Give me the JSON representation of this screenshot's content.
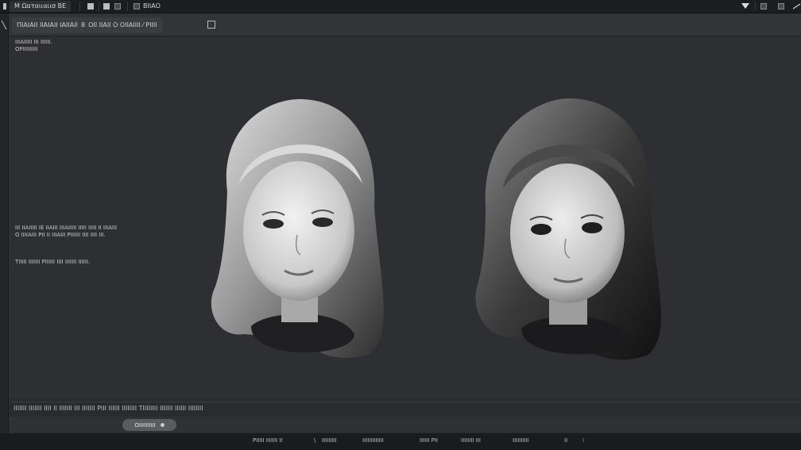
{
  "topbar": {
    "app_title": "M Ωαταιιαιισ ΒΕ",
    "menu_label": "ΒΙΙΑΟ",
    "icons": [
      "window-icon",
      "grid-icon",
      "layers-icon",
      "dropdown-arrow-icon",
      "frame-icon",
      "maximize-icon",
      "close-icon"
    ]
  },
  "tab": {
    "label": "ΠΙΑΙΑΙΙ ΙΙΑΙΑΙΙ ΙΑΙΙΑΙΙ",
    "sep": "8",
    "extra": "ΟΙΙ ΙΙΑΙΙ Ο ΟΙΙΑΙΙΙΙ ⁄ ΡΙΙΙΙ"
  },
  "notes": {
    "top": [
      "ΙΙΙΑΙΙΙΙΙ ΙΙΙ ΙΙΙΙΙΙ.",
      "ΟΡΙΙΙΙΙΙΙΙΙ"
    ],
    "middle": [
      "ΙΙΙ ΙΙΑΙΙΙΙΙ ΙΕ ΙΙΑΙΙΙ ΙΙΙΑΙΙΙΙΙ ΙΙΙΙΙ ΙΙΙΙΙ ΙΙ ΙΙΙΑΙΙΙ",
      "Ο ΙΙΙΙΑΙΙΙ ΡΙΙ ΙΙ ΙΙΙΑΙΙΙ ΡΙΙΙΙΙΙ ΙΙΙΙ ΙΙΙΙ ΙΙΙ."
    ],
    "bottom": "ΤΙΙΙΙΙ ΙΙΙΙΙΙΙ ΡΙΙΙΙΙΙ ΙΙΙΙ ΙΙΙΙΙΙΙ ΙΙΙΙΙΙ."
  },
  "status": "ΙΙΙΙΙΙΙ ΙΙΙΙΙΙΙ ΙΙΙΙ ΙΙ ΙΙΙΙΙΙΙ ΙΙΙ ΙΙΙΙΙΙΙ ΡΙΙΙ ΙΙΙΙΙΙ ΙΙΙΙΙΙΙΙ ΤΙΙΙΙΙΙΙΙ ΙΙΙΙΙΙΙ ΙΙΙΙΙΙ ΙΙΙΙΙΙΙΙ",
  "pill": {
    "label": "ΟΙΙΙΙΙΙΙΙΙΙ"
  },
  "bottombar": [
    "ΡΙΙΙΙΙ ΙΙΙΙΙΙΙ ΙΙ",
    "ΙΙΙΙΙΙΙΙΙ",
    "ΙΙΙΙΙΙΙΙΙΙΙΙΙ",
    "ΙΙΙΙΙΙ ΡΙΙ",
    "ΙΙΙΙΙΙΙΙ ΙΙΙ",
    "ΙΙΙΙΙΙΙΙΙΙ",
    "ΙΙ"
  ],
  "colors": {
    "bg": "#2b2c2f",
    "canvas": "#2e2f32",
    "topbar": "#1c1d1f",
    "text": "#c9c9c9"
  }
}
